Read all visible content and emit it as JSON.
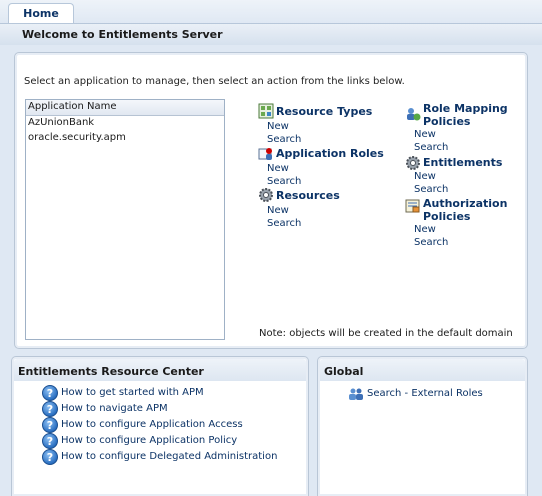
{
  "tabs": [
    {
      "label": "Home"
    }
  ],
  "welcome_title": "Welcome to Entitlements Server",
  "main": {
    "instructions": "Select an application to manage, then select an action from the links below.",
    "app_table": {
      "header": "Application Name",
      "rows": [
        "AzUnionBank",
        "oracle.security.apm"
      ]
    },
    "sections": [
      {
        "title": "Resource Types",
        "icon": "resource-types-icon",
        "links": [
          "New",
          "Search"
        ]
      },
      {
        "title": "Application Roles",
        "icon": "application-roles-icon",
        "links": [
          "New",
          "Search"
        ]
      },
      {
        "title": "Resources",
        "icon": "gear-icon",
        "links": [
          "New",
          "Search"
        ]
      },
      {
        "title_lines": [
          "Role Mapping",
          "Policies"
        ],
        "icon": "role-mapping-icon",
        "links": [
          "New",
          "Search"
        ]
      },
      {
        "title": "Entitlements",
        "icon": "gear-icon",
        "links": [
          "New",
          "Search"
        ]
      },
      {
        "title_lines": [
          "Authorization",
          "Policies"
        ],
        "icon": "authorization-policy-icon",
        "links": [
          "New",
          "Search"
        ]
      }
    ],
    "note": "Note: objects will be created in the default domain"
  },
  "resource_center": {
    "title": "Entitlements Resource Center",
    "items": [
      "How to get started with APM",
      "How to navigate APM",
      "How to configure Application Access",
      "How to configure Application Policy",
      "How to configure Delegated Administration"
    ]
  },
  "global": {
    "title": "Global",
    "link": "Search - External Roles",
    "icon": "users-group-icon"
  },
  "colors": {
    "background": "#dfe8f3",
    "link": "#0c3366",
    "panel_border": "#b9c6d6"
  }
}
